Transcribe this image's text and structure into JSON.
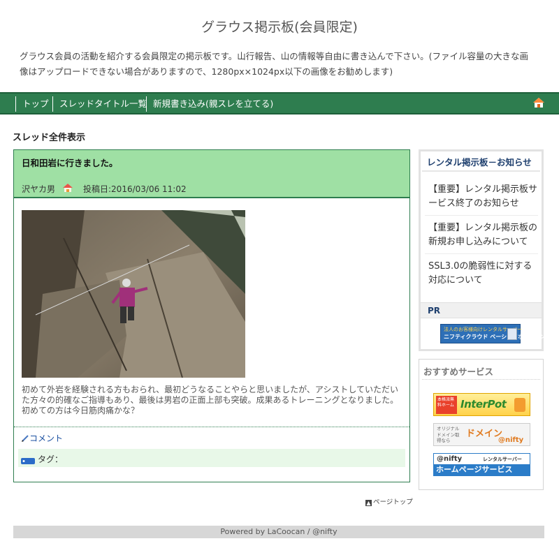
{
  "site": {
    "title": "グラウス掲示板(会員限定)",
    "description": "グラウス会員の活動を紹介する会員限定の掲示板です。山行報告、山の情報等自由に書き込んで下さい。(ファイル容量の大きな画像はアップロードできない場合がありますので、1280px×1024px以下の画像をお勧めします)"
  },
  "nav": {
    "items": [
      {
        "label": "トップ"
      },
      {
        "label": "スレッドタイトル一覧"
      },
      {
        "label": "新規書き込み(親スレを立てる)"
      }
    ],
    "home_icon": "home-icon"
  },
  "main": {
    "section_title": "スレッド全件表示",
    "thread": {
      "title": "日和田岩に行きました。",
      "author": "沢ヤカ男",
      "date": "投稿日:2016/03/06 11:02",
      "body": "初めて外岩を経験される方もおられ、最初どうなることやらと思いましたが、アシストしていただいた方々の的確なご指導もあり、最後は男岩の正面上部も突破。成果あるトレーニングとなりました。初めての方は今日筋肉痛かな？",
      "comment_label": "コメント",
      "tag_label": "タグ："
    },
    "page_top": "ページトップ"
  },
  "sidebar": {
    "notice_title": "レンタル掲示板－お知らせ",
    "notices": [
      {
        "label": "【重要】レンタル掲示板サービス終了のお知らせ"
      },
      {
        "label": "【重要】レンタル掲示板の新規お申し込みについて"
      },
      {
        "label": "SSL3.0の脆弱性に対する対応について"
      }
    ],
    "pr_label": "PR",
    "pr_banner": {
      "small": "法人のお客様向けレンタルサーバー",
      "big": "ニフティクラウド ベーシックホスティング"
    },
    "recommend_title": "おすすめサービス",
    "banners": {
      "interpot": {
        "badge": "本格派無料ホーム",
        "text": "InterPot"
      },
      "domain": {
        "small": "オリジナルドメイン取得なら",
        "text": "ドメイン",
        "brand": "@nifty"
      },
      "homepage": {
        "brand": "@nifty",
        "sub": "レンタルサーバー",
        "text": "ホームページサービス"
      }
    }
  },
  "footer": {
    "text": "Powered by LaCoocan / @nifty"
  },
  "colors": {
    "nav_bg": "#2e7d4f",
    "thread_head_bg": "#9fe0a4",
    "link": "#1a4fa0",
    "sidebar_title": "#1e3f6e"
  }
}
